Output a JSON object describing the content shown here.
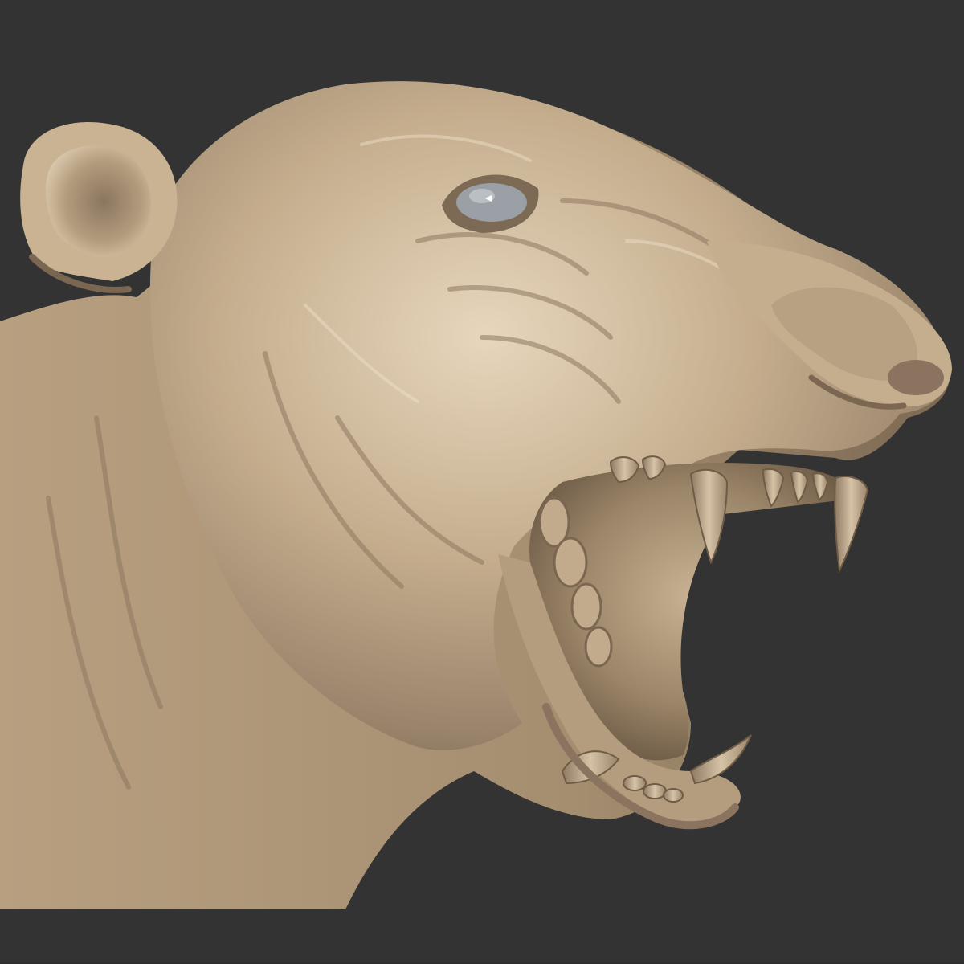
{
  "viewport": {
    "background_color": "#333333",
    "model_color": "#bfa888",
    "model_shadow_color": "#6e5c47",
    "model_highlight_color": "#e7d6bd",
    "eye_color": "#9aa0a6",
    "subject_icon": "sculpted-animal-head-icon"
  }
}
